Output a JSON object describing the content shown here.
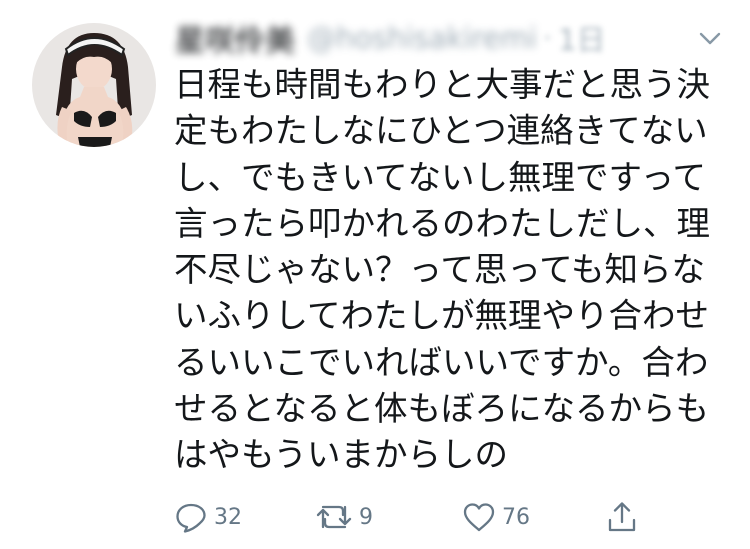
{
  "tweet": {
    "author": {
      "display_name": "星咲伶美",
      "handle": "@hoshisakiremi",
      "separator": "·",
      "time": "1日"
    },
    "menu_icon": "chevron-down-icon",
    "text_lines": [
      "日程も時間もわりと大事だと思う決",
      "定もわたしなにひとつ連絡きてない",
      "し、でもきいてないし無理ですって",
      "言ったら叩かれるのわたしだし、理",
      "不尽じゃない？って思っても知らな",
      "いふりしてわたしが無理やり合わせ",
      "るいいこでいればいいですか。合わ",
      "せるとなると体もぼろになるからも",
      "はやもういまからしの"
    ],
    "actions": {
      "reply": {
        "icon": "reply-icon",
        "count": "32"
      },
      "retweet": {
        "icon": "retweet-icon",
        "count": "9"
      },
      "like": {
        "icon": "heart-icon",
        "count": "76"
      },
      "share": {
        "icon": "share-icon"
      }
    },
    "colors": {
      "text": "#14171a",
      "secondary": "#657786",
      "muted": "#8899a6"
    }
  }
}
